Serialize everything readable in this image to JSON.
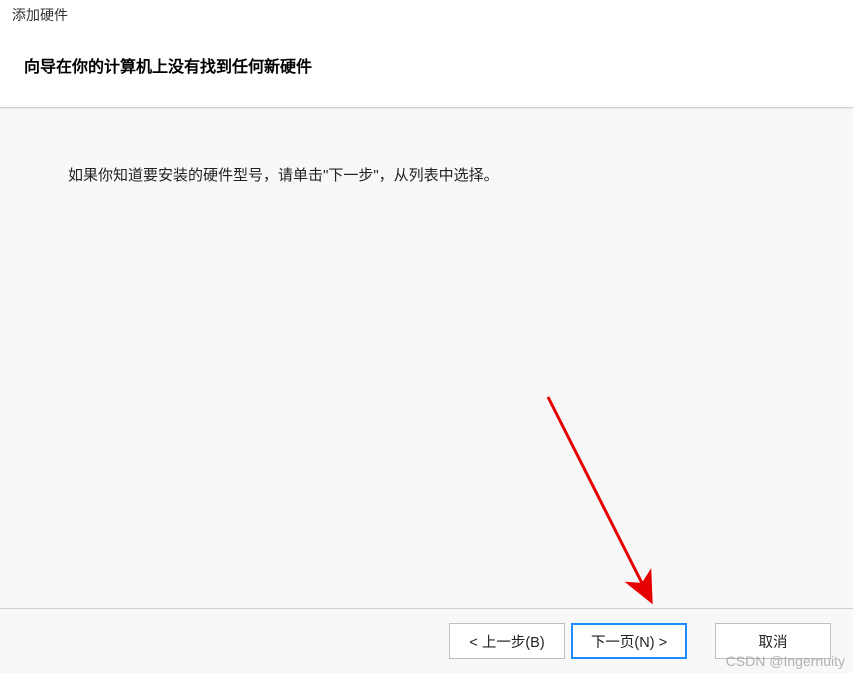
{
  "window": {
    "title": "添加硬件"
  },
  "header": {
    "heading": "向导在你的计算机上没有找到任何新硬件"
  },
  "content": {
    "instruction": "如果你知道要安装的硬件型号，请单击\"下一步\"，从列表中选择。"
  },
  "buttons": {
    "back": "< 上一步(B)",
    "next": "下一页(N) >",
    "cancel": "取消"
  },
  "watermark": "CSDN @Ingernuity"
}
